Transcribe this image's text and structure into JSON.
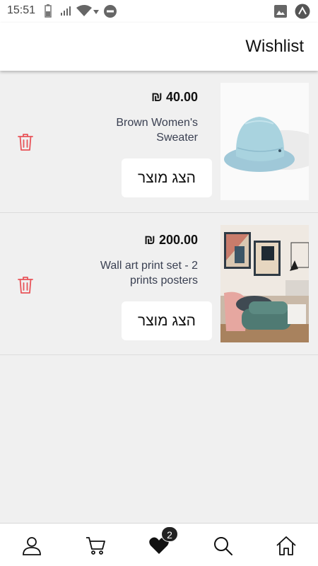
{
  "status_bar": {
    "time": "15:51"
  },
  "header": {
    "title": "Wishlist"
  },
  "wishlist": [
    {
      "price": "₪ 40.00",
      "name": "Brown Women's Sweater",
      "button_label": "הצג מוצר",
      "image": "bucket-hat-photo"
    },
    {
      "price": "₪ 200.00",
      "name": "Wall art print set - 2 prints posters",
      "button_label": "הצג מוצר",
      "image": "living-room-wall-art-photo"
    }
  ],
  "bottom_nav": {
    "items": [
      "account",
      "cart",
      "wishlist",
      "search",
      "home"
    ],
    "wishlist_badge": "2",
    "active": "wishlist"
  },
  "colors": {
    "trash": "#e8545a",
    "background": "#f0f0f0",
    "name_text": "#3a4052"
  }
}
